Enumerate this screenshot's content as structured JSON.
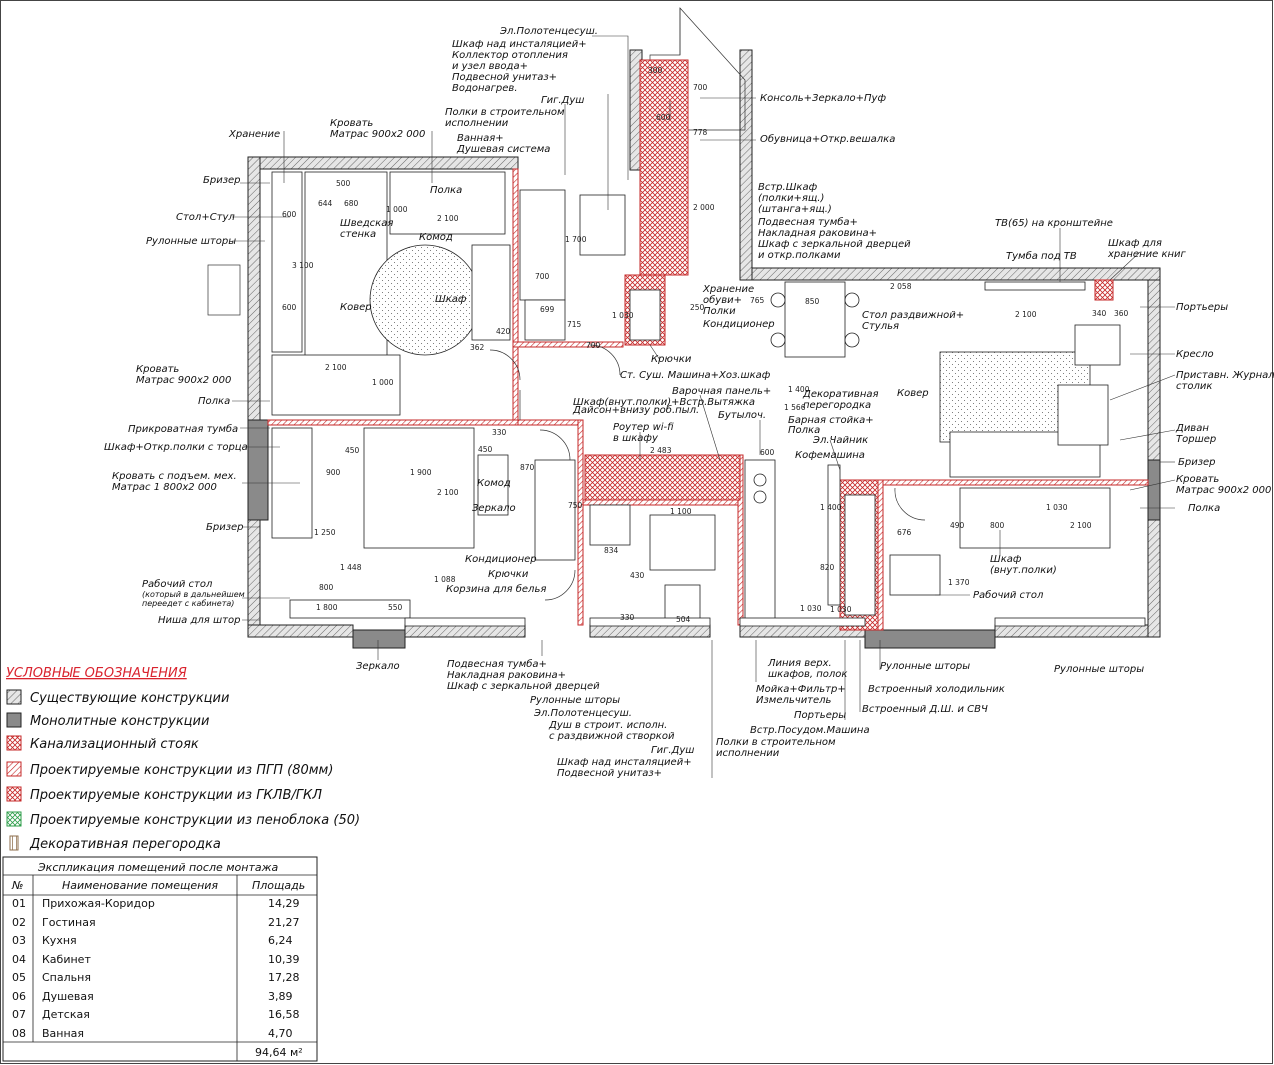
{
  "labels": [
    {
      "id": "towel-top",
      "text": "Эл.Полотенцесуш."
    },
    {
      "id": "wc-cabinet-1",
      "text": "Шкаф над инсталяцией+"
    },
    {
      "id": "wc-cabinet-2",
      "text": "Коллектор отопления"
    },
    {
      "id": "wc-cabinet-3",
      "text": "и узел ввода+"
    },
    {
      "id": "wc-cabinet-4",
      "text": "Подвесной унитаз+"
    },
    {
      "id": "wc-cabinet-5",
      "text": "Водонагрев."
    },
    {
      "id": "gig-shower-top",
      "text": "Гиг.Душ"
    },
    {
      "id": "shelves-top-1",
      "text": "Полки в строительном"
    },
    {
      "id": "shelves-top-2",
      "text": "исполнении"
    },
    {
      "id": "bath-1",
      "text": "Ванная+"
    },
    {
      "id": "bath-2",
      "text": "Душевая система"
    },
    {
      "id": "storage-left",
      "text": "Хранение"
    },
    {
      "id": "bed-top-1",
      "text": "Кровать"
    },
    {
      "id": "bed-top-2",
      "text": "Матрас 900x2 000"
    },
    {
      "id": "shelf-top",
      "text": "Полка"
    },
    {
      "id": "breather-left-top",
      "text": "Бризер"
    },
    {
      "id": "desk-chair",
      "text": "Стол+Стул"
    },
    {
      "id": "swedish-1",
      "text": "Шведская"
    },
    {
      "id": "swedish-2",
      "text": "стенка"
    },
    {
      "id": "dresser-top",
      "text": "Комод"
    },
    {
      "id": "roll-blinds-left",
      "text": "Рулонные шторы"
    },
    {
      "id": "rug-left",
      "text": "Ковер"
    },
    {
      "id": "wardrobe-kids",
      "text": "Шкаф"
    },
    {
      "id": "console",
      "text": "Консоль+Зеркало+Пуф"
    },
    {
      "id": "shoe-cabinet",
      "text": "Обувница+Откр.вешалка"
    },
    {
      "id": "built-in-1",
      "text": "Встр.Шкаф"
    },
    {
      "id": "built-in-2",
      "text": "(полки+ящ.)"
    },
    {
      "id": "built-in-3",
      "text": "(штанга+ящ.)"
    },
    {
      "id": "built-in-4",
      "text": "Подвесная тумба+"
    },
    {
      "id": "built-in-5",
      "text": "Накладная раковина+"
    },
    {
      "id": "built-in-6",
      "text": "Шкаф с зеркальной дверцей"
    },
    {
      "id": "built-in-7",
      "text": "и откр.полками"
    },
    {
      "id": "tv",
      "text": "ТВ(65) на кронштейне"
    },
    {
      "id": "tv-stand",
      "text": "Тумба под ТВ"
    },
    {
      "id": "bookcase-1",
      "text": "Шкаф для"
    },
    {
      "id": "bookcase-2",
      "text": "хранение книг"
    },
    {
      "id": "shoe-storage-1",
      "text": "Хранение"
    },
    {
      "id": "shoe-storage-2",
      "text": "обуви+"
    },
    {
      "id": "shoe-storage-3",
      "text": "Полки"
    },
    {
      "id": "ac-hall",
      "text": "Кондиционер"
    },
    {
      "id": "table-1",
      "text": "Стол раздвижной+"
    },
    {
      "id": "table-2",
      "text": "Стулья"
    },
    {
      "id": "curtains-right",
      "text": "Портьеры"
    },
    {
      "id": "armchair",
      "text": "Кресло"
    },
    {
      "id": "side-table-1",
      "text": "Приставн. Журнал."
    },
    {
      "id": "side-table-2",
      "text": "столик"
    },
    {
      "id": "sofa",
      "text": "Диван"
    },
    {
      "id": "floor-lamp",
      "text": "Торшер"
    },
    {
      "id": "breather-right",
      "text": "Бризер"
    },
    {
      "id": "bed-right-1",
      "text": "Кровать"
    },
    {
      "id": "bed-right-2",
      "text": "Матрас 900x2 000"
    },
    {
      "id": "shelf-right",
      "text": "Полка"
    },
    {
      "id": "hooks-top",
      "text": "Крючки"
    },
    {
      "id": "dryer",
      "text": "Ст. Суш. Машина+Хоз.шкаф"
    },
    {
      "id": "hob-1",
      "text": "Варочная панель+"
    },
    {
      "id": "hob-2",
      "text": "Шкаф(внут.полки)+Встр.Вытяжка"
    },
    {
      "id": "dyson",
      "text": "Дайсон+внизу роб.пыл."
    },
    {
      "id": "router-1",
      "text": "Роутер wi-fi"
    },
    {
      "id": "router-2",
      "text": "в шкафу"
    },
    {
      "id": "bottle",
      "text": "Бутылоч."
    },
    {
      "id": "deco-1",
      "text": "Декоративная"
    },
    {
      "id": "deco-2",
      "text": "перегородка"
    },
    {
      "id": "bar-1",
      "text": "Барная стойка+"
    },
    {
      "id": "bar-2",
      "text": "Полка"
    },
    {
      "id": "kettle",
      "text": "Эл.Чайник"
    },
    {
      "id": "coffee",
      "text": "Кофемашина"
    },
    {
      "id": "rug-right",
      "text": "Ковер"
    },
    {
      "id": "wardrobe-right-1",
      "text": "Шкаф"
    },
    {
      "id": "wardrobe-right-2",
      "text": "(внут.полки)"
    },
    {
      "id": "desk-right",
      "text": "Рабочий стол"
    },
    {
      "id": "bed-shelf",
      "text": "Кровать"
    },
    {
      "id": "bed-shelf-2",
      "text": "Матрас 900x2 000"
    },
    {
      "id": "shelf-left",
      "text": "Полка"
    },
    {
      "id": "bedside",
      "text": "Прикроватная тумба"
    },
    {
      "id": "wardrobe-side",
      "text": "Шкаф+Откр.полки с торца"
    },
    {
      "id": "bed-lift-1",
      "text": "Кровать с подъем. мех."
    },
    {
      "id": "bed-lift-2",
      "text": "Матрас 1 800x2 000"
    },
    {
      "id": "breather-left-bottom",
      "text": "Бризер"
    },
    {
      "id": "dresser-bottom",
      "text": "Комод"
    },
    {
      "id": "mirror-bed",
      "text": "Зеркало"
    },
    {
      "id": "ac-bedroom",
      "text": "Кондиционер"
    },
    {
      "id": "hooks-bottom",
      "text": "Крючки"
    },
    {
      "id": "laundry",
      "text": "Корзина для белья"
    },
    {
      "id": "desk-left-1",
      "text": "Рабочий стол"
    },
    {
      "id": "desk-left-2",
      "text": "(который в дальнейшем"
    },
    {
      "id": "desk-left-3",
      "text": "переедет с кабинета)"
    },
    {
      "id": "niche",
      "text": "Ниша для штор"
    },
    {
      "id": "mirror-bottom",
      "text": "Зеркало"
    },
    {
      "id": "shower-1",
      "text": "Подвесная тумба+"
    },
    {
      "id": "shower-2",
      "text": "Накладная раковина+"
    },
    {
      "id": "shower-3",
      "text": "Шкаф с зеркальной дверцей"
    },
    {
      "id": "roll-blinds-mid",
      "text": "Рулонные шторы"
    },
    {
      "id": "towel-bottom",
      "text": "Эл.Полотенцесуш."
    },
    {
      "id": "shower-4",
      "text": "Душ в строит. исполн."
    },
    {
      "id": "shower-5",
      "text": "с раздвижной створкой"
    },
    {
      "id": "gig-shower-bottom",
      "text": "Гиг.Душ"
    },
    {
      "id": "wc-bottom-1",
      "text": "Шкаф над инсталяцией+"
    },
    {
      "id": "wc-bottom-2",
      "text": "Подвесной унитаз+"
    },
    {
      "id": "upper-1",
      "text": "Линия верх."
    },
    {
      "id": "upper-2",
      "text": "шкафов, полок"
    },
    {
      "id": "sink-1",
      "text": "Мойка+Фильтр+"
    },
    {
      "id": "sink-2",
      "text": "Измельчитель"
    },
    {
      "id": "curtains-kitchen",
      "text": "Портьеры"
    },
    {
      "id": "dishwasher",
      "text": "Встр.Посудом.Машина"
    },
    {
      "id": "shelves-b-1",
      "text": "Полки в строительном"
    },
    {
      "id": "shelves-b-2",
      "text": "исполнении"
    },
    {
      "id": "roll-blinds-kitchen",
      "text": "Рулонные шторы"
    },
    {
      "id": "fridge",
      "text": "Встроенный холодильник"
    },
    {
      "id": "dw-micro",
      "text": "Встроенный Д.Ш. и СВЧ"
    },
    {
      "id": "roll-blinds-right",
      "text": "Рулонные шторы"
    }
  ],
  "dimensions": [
    "300",
    "700",
    "600",
    "778",
    "2 000",
    "765",
    "850",
    "1 400",
    "2 058",
    "2 100",
    "340",
    "360",
    "500",
    "644",
    "680",
    "1 000",
    "2 100",
    "600",
    "3 100",
    "600",
    "700",
    "699",
    "420",
    "1 700",
    "1 030",
    "715",
    "250",
    "362",
    "700",
    "2 100",
    "1 000",
    "450",
    "900",
    "450",
    "330",
    "1 900",
    "2 100",
    "870",
    "750",
    "1 250",
    "1 448",
    "800",
    "1 800",
    "550",
    "1 088",
    "330",
    "834",
    "1 100",
    "2 483",
    "504",
    "430",
    "1 566",
    "1 030",
    "820",
    "1 030",
    "600",
    "1 400",
    "490",
    "800",
    "2 100",
    "1 370",
    "676",
    "1 030"
  ],
  "legend": {
    "title": "УСЛОВНЫЕ ОБОЗНАЧЕНИЯ",
    "items": [
      {
        "text": "Существующие конструкции",
        "symbol": "hatch-grey"
      },
      {
        "text": "Монолитные конструкции",
        "symbol": "solid-grey"
      },
      {
        "text": "Канализационный стояк",
        "symbol": "cross-red"
      },
      {
        "text": "Проектируемые конструкции из ПГП (80мм)",
        "symbol": "hatch-red"
      },
      {
        "text": "Проектируемые конструкции из ГКЛВ/ГКЛ",
        "symbol": "cross-red"
      },
      {
        "text": "Проектируемые конструкции из пеноблока (50)",
        "symbol": "cross-green"
      },
      {
        "text": "Декоративная перегородка",
        "symbol": "brown-bars"
      }
    ]
  },
  "rooms_table": {
    "title": "Экспликация помещений после монтажа",
    "headers": [
      "№",
      "Наименование помещения",
      "Площадь"
    ],
    "rows": [
      [
        "01",
        "Прихожая-Коридор",
        "14,29"
      ],
      [
        "02",
        "Гостиная",
        "21,27"
      ],
      [
        "03",
        "Кухня",
        "6,24"
      ],
      [
        "04",
        "Кабинет",
        "10,39"
      ],
      [
        "05",
        "Спальня",
        "17,28"
      ],
      [
        "06",
        "Душевая",
        "3,89"
      ],
      [
        "07",
        "Детская",
        "16,58"
      ],
      [
        "08",
        "Ванная",
        "4,70"
      ]
    ],
    "total": "94,64 м²"
  },
  "colors": {
    "red": "#c62828",
    "grey": "#8a8a8a",
    "green": "#2e9e4a",
    "brown": "#8d6e4b"
  }
}
